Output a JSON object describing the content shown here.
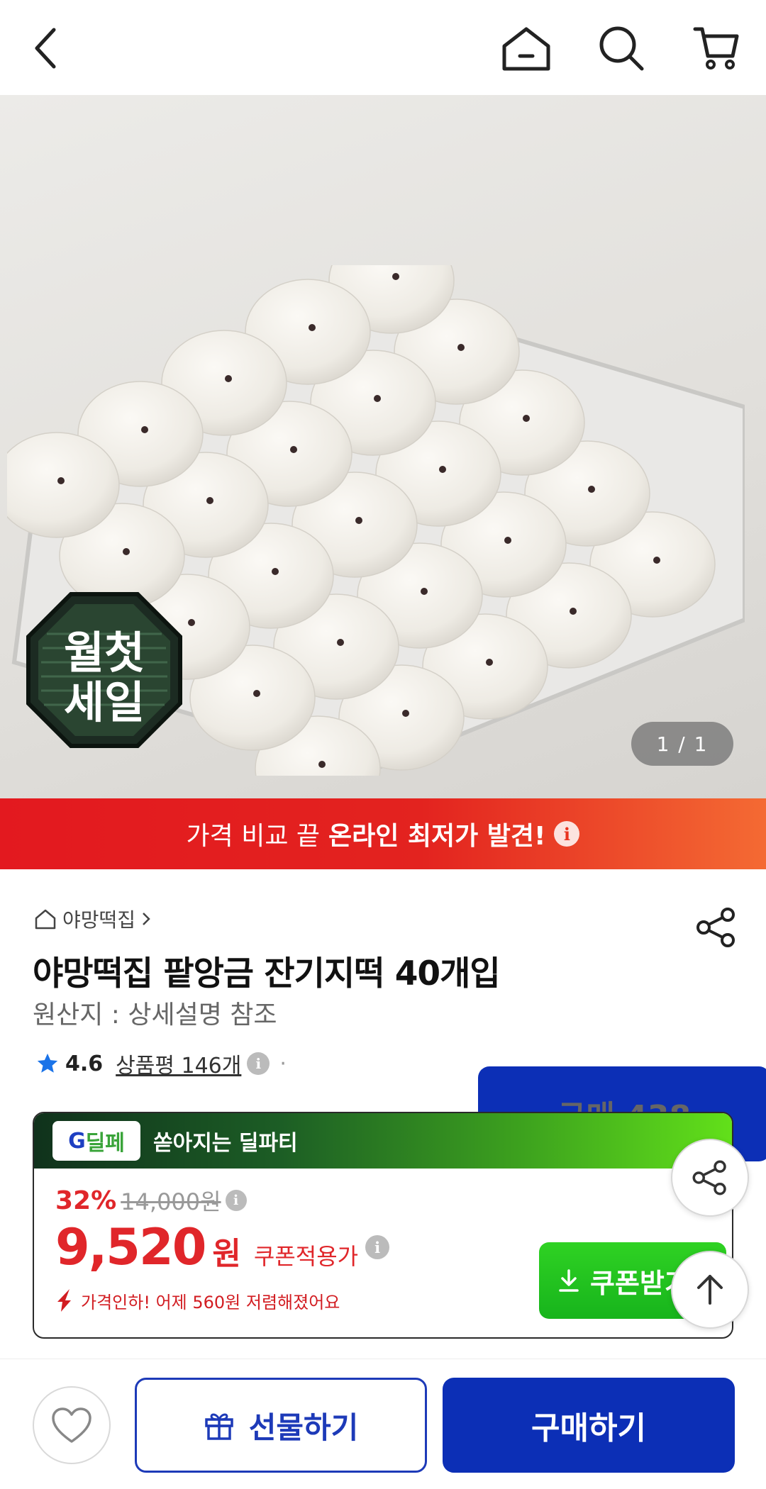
{
  "header": {
    "icons": [
      "back-icon",
      "home-icon",
      "search-icon",
      "cart-icon"
    ]
  },
  "hero": {
    "badge_text_line1": "월첫",
    "badge_text_line2": "세일",
    "pager": "1 / 1"
  },
  "promo": {
    "prefix": "가격 비교 끝",
    "strong": "온라인 최저가 발견!",
    "info": "i"
  },
  "product": {
    "shop_name": "야망떡집",
    "title": "야망떡집 팥앙금 잔기지떡 40개입",
    "origin": "원산지 : 상세설명 참조",
    "rating": "4.6",
    "reviews": "상품평 146개",
    "purchases": "구매 438"
  },
  "deal": {
    "brand_g": "G",
    "brand_rest": "딜페",
    "headline": "쏟아지는 딜파티",
    "discount": "32%",
    "original_price": "14,000원",
    "price": "9,520",
    "price_unit": "원",
    "price_label": "쿠폰적용가",
    "price_drop": "가격인하! 어제 560원 저렴해졌어요",
    "coupon_button": "쿠폰받기"
  },
  "bottom": {
    "gift_label": "선물하기",
    "buy_label": "구매하기"
  },
  "colors": {
    "accent_red": "#e0262a",
    "primary_blue": "#0c2fb6",
    "coupon_green": "#17b41c",
    "rating_star": "#1a73e8"
  }
}
